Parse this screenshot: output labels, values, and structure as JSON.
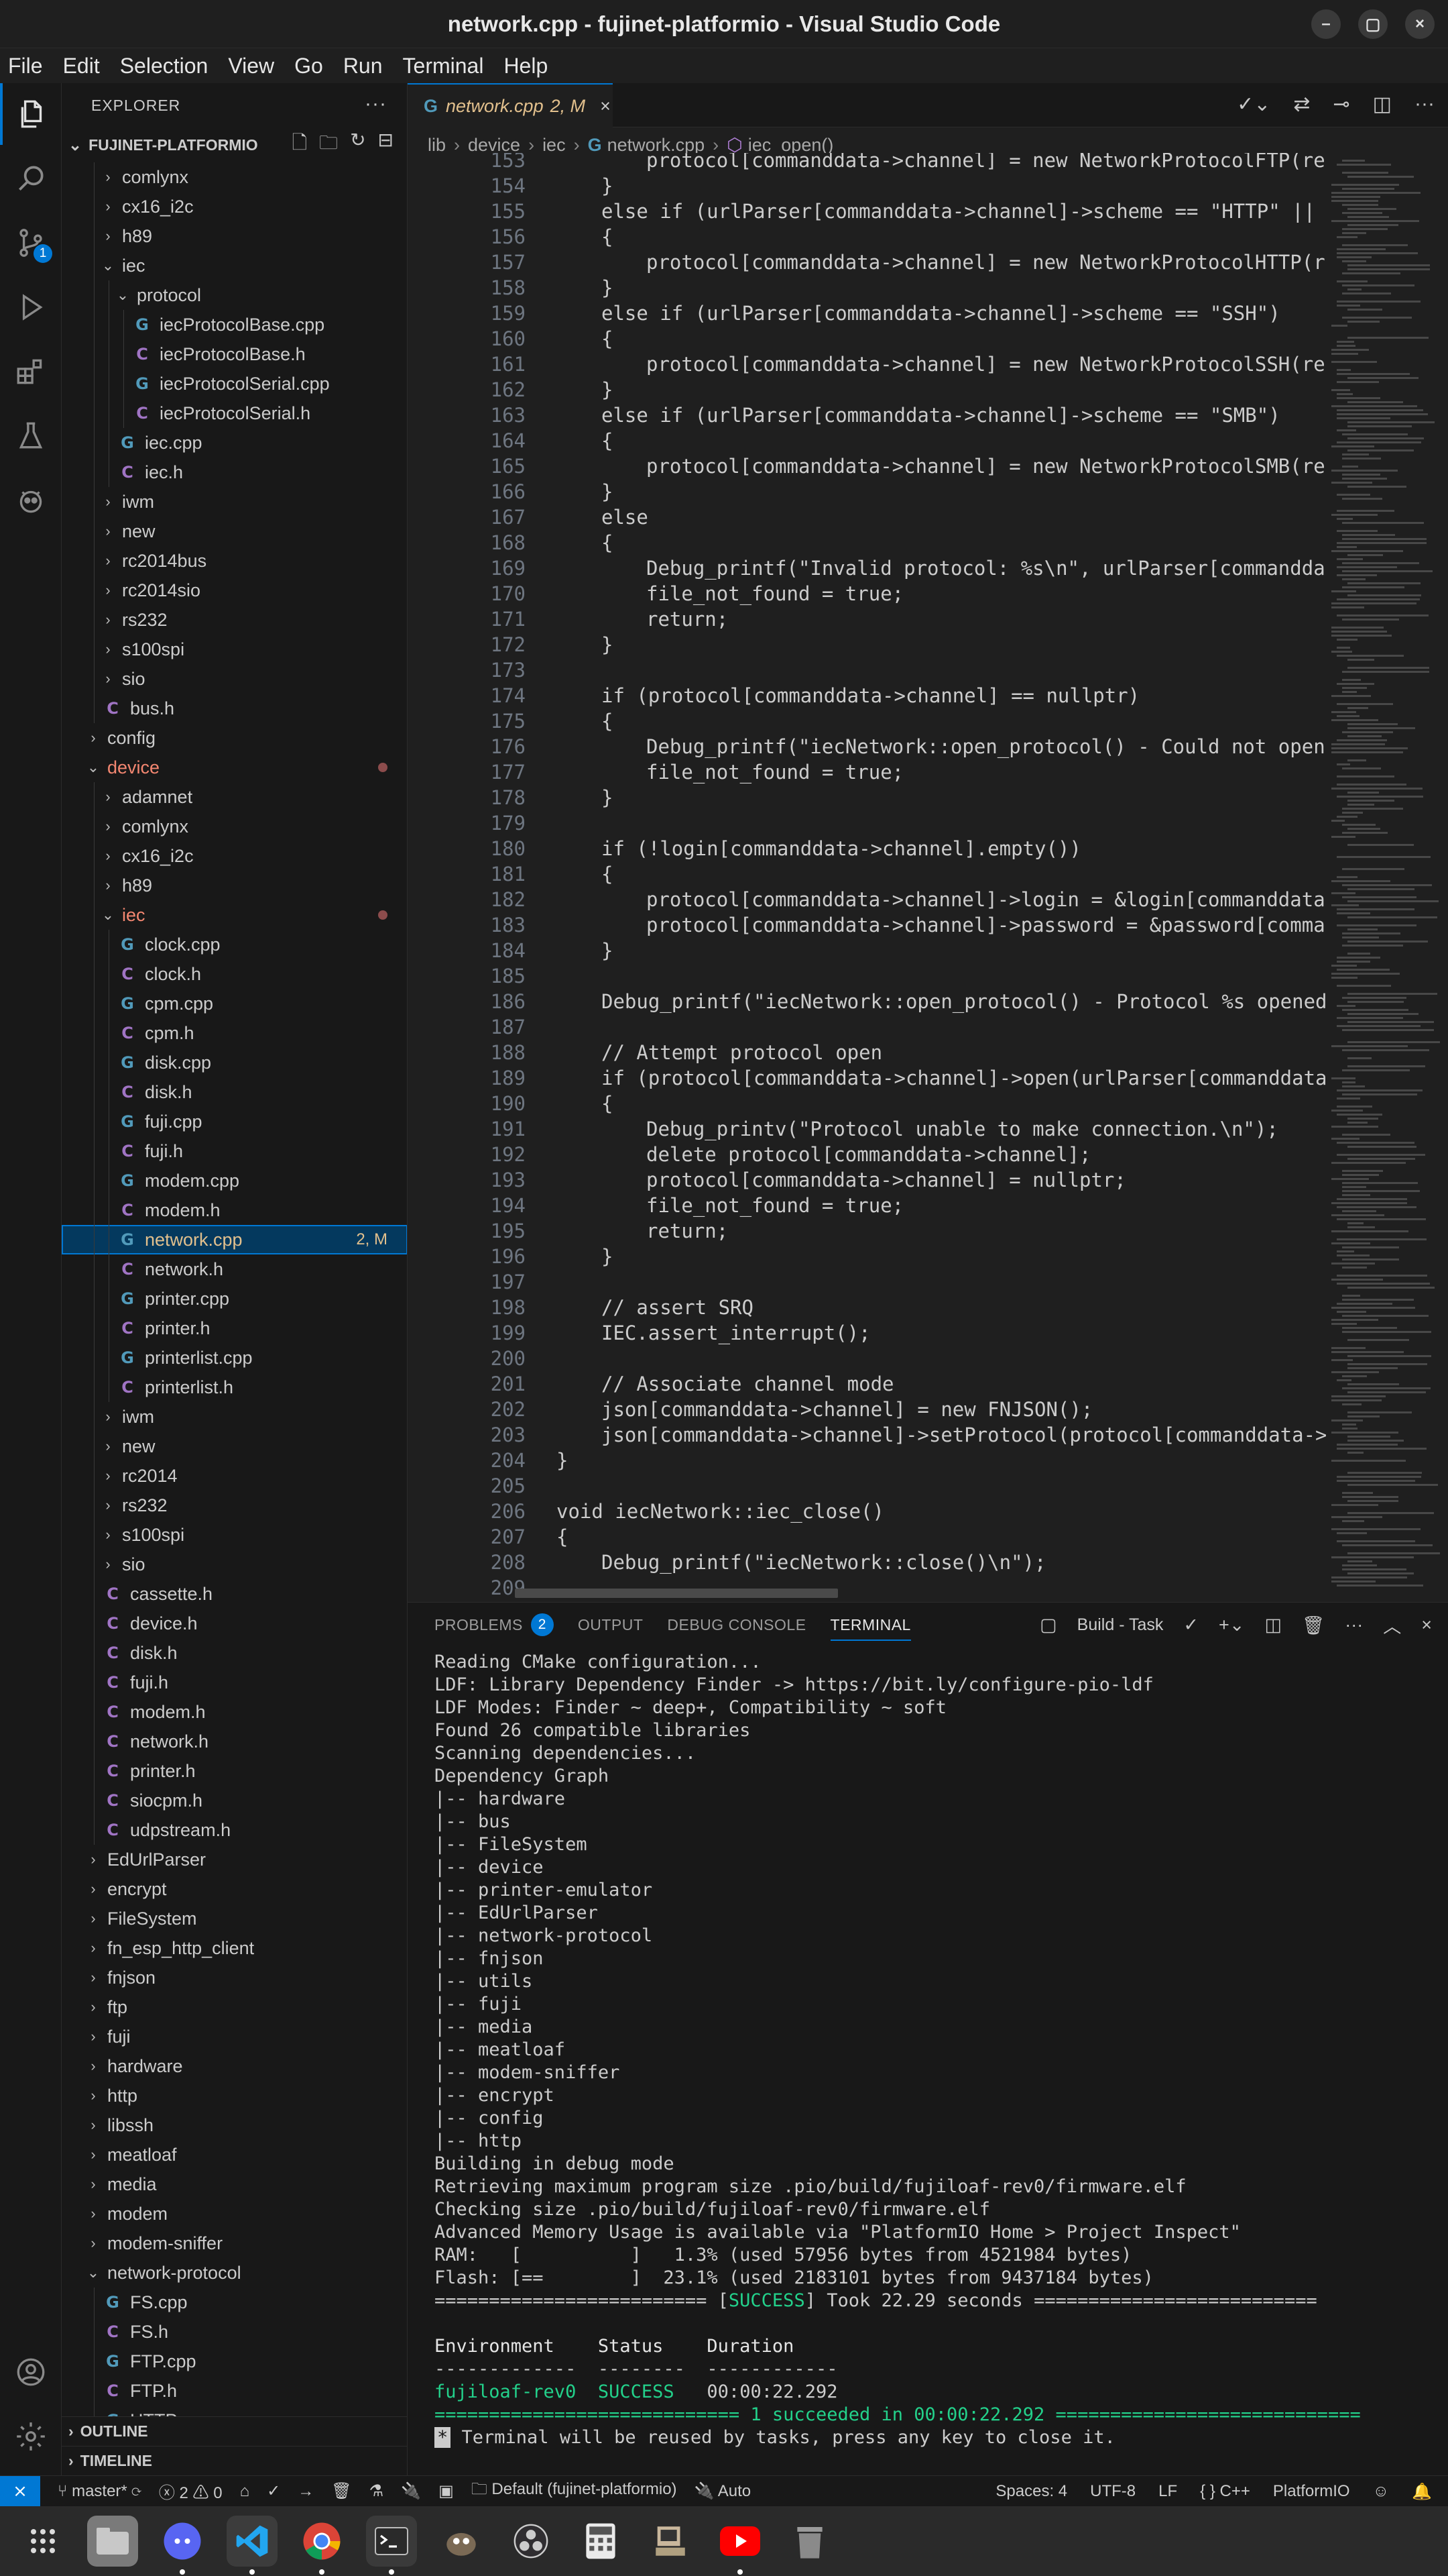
{
  "window": {
    "title": "network.cpp - fujinet-platformio - Visual Studio Code"
  },
  "menu": [
    "File",
    "Edit",
    "Selection",
    "View",
    "Go",
    "Run",
    "Terminal",
    "Help"
  ],
  "activity": {
    "scm_badge": "1"
  },
  "sidebar": {
    "title": "EXPLORER",
    "root": "FUJINET-PLATFORMIO",
    "tree": [
      {
        "label": "comlynx",
        "depth": 2,
        "kind": "folder",
        "open": false
      },
      {
        "label": "cx16_i2c",
        "depth": 2,
        "kind": "folder",
        "open": false
      },
      {
        "label": "h89",
        "depth": 2,
        "kind": "folder",
        "open": false
      },
      {
        "label": "iec",
        "depth": 2,
        "kind": "folder",
        "open": true
      },
      {
        "label": "protocol",
        "depth": 3,
        "kind": "folder",
        "open": true
      },
      {
        "label": "iecProtocolBase.cpp",
        "depth": 4,
        "kind": "cpp"
      },
      {
        "label": "iecProtocolBase.h",
        "depth": 4,
        "kind": "h"
      },
      {
        "label": "iecProtocolSerial.cpp",
        "depth": 4,
        "kind": "cpp"
      },
      {
        "label": "iecProtocolSerial.h",
        "depth": 4,
        "kind": "h"
      },
      {
        "label": "iec.cpp",
        "depth": 3,
        "kind": "cpp"
      },
      {
        "label": "iec.h",
        "depth": 3,
        "kind": "h"
      },
      {
        "label": "iwm",
        "depth": 2,
        "kind": "folder",
        "open": false
      },
      {
        "label": "new",
        "depth": 2,
        "kind": "folder",
        "open": false
      },
      {
        "label": "rc2014bus",
        "depth": 2,
        "kind": "folder",
        "open": false
      },
      {
        "label": "rc2014sio",
        "depth": 2,
        "kind": "folder",
        "open": false
      },
      {
        "label": "rs232",
        "depth": 2,
        "kind": "folder",
        "open": false
      },
      {
        "label": "s100spi",
        "depth": 2,
        "kind": "folder",
        "open": false
      },
      {
        "label": "sio",
        "depth": 2,
        "kind": "folder",
        "open": false
      },
      {
        "label": "bus.h",
        "depth": 2,
        "kind": "h"
      },
      {
        "label": "config",
        "depth": 1,
        "kind": "folder",
        "open": false
      },
      {
        "label": "device",
        "depth": 1,
        "kind": "folder",
        "open": true,
        "err": true
      },
      {
        "label": "adamnet",
        "depth": 2,
        "kind": "folder",
        "open": false
      },
      {
        "label": "comlynx",
        "depth": 2,
        "kind": "folder",
        "open": false
      },
      {
        "label": "cx16_i2c",
        "depth": 2,
        "kind": "folder",
        "open": false
      },
      {
        "label": "h89",
        "depth": 2,
        "kind": "folder",
        "open": false
      },
      {
        "label": "iec",
        "depth": 2,
        "kind": "folder",
        "open": true,
        "err": true
      },
      {
        "label": "clock.cpp",
        "depth": 3,
        "kind": "cpp"
      },
      {
        "label": "clock.h",
        "depth": 3,
        "kind": "h"
      },
      {
        "label": "cpm.cpp",
        "depth": 3,
        "kind": "cpp"
      },
      {
        "label": "cpm.h",
        "depth": 3,
        "kind": "h"
      },
      {
        "label": "disk.cpp",
        "depth": 3,
        "kind": "cpp"
      },
      {
        "label": "disk.h",
        "depth": 3,
        "kind": "h"
      },
      {
        "label": "fuji.cpp",
        "depth": 3,
        "kind": "cpp"
      },
      {
        "label": "fuji.h",
        "depth": 3,
        "kind": "h"
      },
      {
        "label": "modem.cpp",
        "depth": 3,
        "kind": "cpp"
      },
      {
        "label": "modem.h",
        "depth": 3,
        "kind": "h"
      },
      {
        "label": "network.cpp",
        "depth": 3,
        "kind": "cpp",
        "selected": true,
        "status": "2, M"
      },
      {
        "label": "network.h",
        "depth": 3,
        "kind": "h"
      },
      {
        "label": "printer.cpp",
        "depth": 3,
        "kind": "cpp"
      },
      {
        "label": "printer.h",
        "depth": 3,
        "kind": "h"
      },
      {
        "label": "printerlist.cpp",
        "depth": 3,
        "kind": "cpp"
      },
      {
        "label": "printerlist.h",
        "depth": 3,
        "kind": "h"
      },
      {
        "label": "iwm",
        "depth": 2,
        "kind": "folder",
        "open": false
      },
      {
        "label": "new",
        "depth": 2,
        "kind": "folder",
        "open": false
      },
      {
        "label": "rc2014",
        "depth": 2,
        "kind": "folder",
        "open": false
      },
      {
        "label": "rs232",
        "depth": 2,
        "kind": "folder",
        "open": false
      },
      {
        "label": "s100spi",
        "depth": 2,
        "kind": "folder",
        "open": false
      },
      {
        "label": "sio",
        "depth": 2,
        "kind": "folder",
        "open": false
      },
      {
        "label": "cassette.h",
        "depth": 2,
        "kind": "h"
      },
      {
        "label": "device.h",
        "depth": 2,
        "kind": "h"
      },
      {
        "label": "disk.h",
        "depth": 2,
        "kind": "h"
      },
      {
        "label": "fuji.h",
        "depth": 2,
        "kind": "h"
      },
      {
        "label": "modem.h",
        "depth": 2,
        "kind": "h"
      },
      {
        "label": "network.h",
        "depth": 2,
        "kind": "h"
      },
      {
        "label": "printer.h",
        "depth": 2,
        "kind": "h"
      },
      {
        "label": "siocpm.h",
        "depth": 2,
        "kind": "h"
      },
      {
        "label": "udpstream.h",
        "depth": 2,
        "kind": "h"
      },
      {
        "label": "EdUrlParser",
        "depth": 1,
        "kind": "folder",
        "open": false
      },
      {
        "label": "encrypt",
        "depth": 1,
        "kind": "folder",
        "open": false
      },
      {
        "label": "FileSystem",
        "depth": 1,
        "kind": "folder",
        "open": false
      },
      {
        "label": "fn_esp_http_client",
        "depth": 1,
        "kind": "folder",
        "open": false
      },
      {
        "label": "fnjson",
        "depth": 1,
        "kind": "folder",
        "open": false
      },
      {
        "label": "ftp",
        "depth": 1,
        "kind": "folder",
        "open": false
      },
      {
        "label": "fuji",
        "depth": 1,
        "kind": "folder",
        "open": false
      },
      {
        "label": "hardware",
        "depth": 1,
        "kind": "folder",
        "open": false
      },
      {
        "label": "http",
        "depth": 1,
        "kind": "folder",
        "open": false
      },
      {
        "label": "libssh",
        "depth": 1,
        "kind": "folder",
        "open": false
      },
      {
        "label": "meatloaf",
        "depth": 1,
        "kind": "folder",
        "open": false
      },
      {
        "label": "media",
        "depth": 1,
        "kind": "folder",
        "open": false
      },
      {
        "label": "modem",
        "depth": 1,
        "kind": "folder",
        "open": false
      },
      {
        "label": "modem-sniffer",
        "depth": 1,
        "kind": "folder",
        "open": false
      },
      {
        "label": "network-protocol",
        "depth": 1,
        "kind": "folder",
        "open": true
      },
      {
        "label": "FS.cpp",
        "depth": 2,
        "kind": "cpp"
      },
      {
        "label": "FS.h",
        "depth": 2,
        "kind": "h"
      },
      {
        "label": "FTP.cpp",
        "depth": 2,
        "kind": "cpp"
      },
      {
        "label": "FTP.h",
        "depth": 2,
        "kind": "h"
      },
      {
        "label": "HTTP",
        "depth": 2,
        "kind": "cpp"
      }
    ],
    "outline": "OUTLINE",
    "timeline": "TIMELINE"
  },
  "editor": {
    "tab": {
      "name": "network.cpp",
      "meta": "2, M",
      "close": "×"
    },
    "breadcrumb": [
      "lib",
      "device",
      "iec",
      "network.cpp",
      "iec_open()"
    ],
    "lines": [
      {
        "n": "153",
        "i": 2,
        "t": "protocol[commanddata->channel] = new NetworkProtocolFTP(receiveB"
      },
      {
        "n": "154",
        "i": 1,
        "t": "}"
      },
      {
        "n": "155",
        "i": 1,
        "t": "else if (urlParser[commanddata->channel]->scheme == \"HTTP\" || urlPar"
      },
      {
        "n": "156",
        "i": 1,
        "t": "{"
      },
      {
        "n": "157",
        "i": 2,
        "t": "protocol[commanddata->channel] = new NetworkProtocolHTTP(receive"
      },
      {
        "n": "158",
        "i": 1,
        "t": "}"
      },
      {
        "n": "159",
        "i": 1,
        "t": "else if (urlParser[commanddata->channel]->scheme == \"SSH\")"
      },
      {
        "n": "160",
        "i": 1,
        "t": "{"
      },
      {
        "n": "161",
        "i": 2,
        "t": "protocol[commanddata->channel] = new NetworkProtocolSSH(receiveB"
      },
      {
        "n": "162",
        "i": 1,
        "t": "}"
      },
      {
        "n": "163",
        "i": 1,
        "t": "else if (urlParser[commanddata->channel]->scheme == \"SMB\")"
      },
      {
        "n": "164",
        "i": 1,
        "t": "{"
      },
      {
        "n": "165",
        "i": 2,
        "t": "protocol[commanddata->channel] = new NetworkProtocolSMB(receiveB"
      },
      {
        "n": "166",
        "i": 1,
        "t": "}"
      },
      {
        "n": "167",
        "i": 1,
        "t": "else"
      },
      {
        "n": "168",
        "i": 1,
        "t": "{"
      },
      {
        "n": "169",
        "i": 2,
        "t": "Debug_printf(\"Invalid protocol: %s\\n\", urlParser[commanddata->ch"
      },
      {
        "n": "170",
        "i": 2,
        "t": "file_not_found = true;"
      },
      {
        "n": "171",
        "i": 2,
        "t": "return;"
      },
      {
        "n": "172",
        "i": 1,
        "t": "}"
      },
      {
        "n": "173",
        "i": 0,
        "t": ""
      },
      {
        "n": "174",
        "i": 1,
        "t": "if (protocol[commanddata->channel] == nullptr)"
      },
      {
        "n": "175",
        "i": 1,
        "t": "{"
      },
      {
        "n": "176",
        "i": 2,
        "t": "Debug_printf(\"iecNetwork::open_protocol() - Could not open proto"
      },
      {
        "n": "177",
        "i": 2,
        "t": "file_not_found = true;"
      },
      {
        "n": "178",
        "i": 1,
        "t": "}"
      },
      {
        "n": "179",
        "i": 0,
        "t": ""
      },
      {
        "n": "180",
        "i": 1,
        "t": "if (!login[commanddata->channel].empty())"
      },
      {
        "n": "181",
        "i": 1,
        "t": "{"
      },
      {
        "n": "182",
        "i": 2,
        "t": "protocol[commanddata->channel]->login = &login[commanddata->chan"
      },
      {
        "n": "183",
        "i": 2,
        "t": "protocol[commanddata->channel]->password = &password[commanddata"
      },
      {
        "n": "184",
        "i": 1,
        "t": "}"
      },
      {
        "n": "185",
        "i": 0,
        "t": ""
      },
      {
        "n": "186",
        "i": 1,
        "t": "Debug_printf(\"iecNetwork::open_protocol() - Protocol %s opened.\\n\","
      },
      {
        "n": "187",
        "i": 0,
        "t": ""
      },
      {
        "n": "188",
        "i": 1,
        "t": "// Attempt protocol open"
      },
      {
        "n": "189",
        "i": 1,
        "t": "if (protocol[commanddata->channel]->open(urlParser[commanddata->chan"
      },
      {
        "n": "190",
        "i": 1,
        "t": "{"
      },
      {
        "n": "191",
        "i": 2,
        "t": "Debug_printv(\"Protocol unable to make connection.\\n\");"
      },
      {
        "n": "192",
        "i": 2,
        "t": "delete protocol[commanddata->channel];"
      },
      {
        "n": "193",
        "i": 2,
        "t": "protocol[commanddata->channel] = nullptr;"
      },
      {
        "n": "194",
        "i": 2,
        "t": "file_not_found = true;"
      },
      {
        "n": "195",
        "i": 2,
        "t": "return;"
      },
      {
        "n": "196",
        "i": 1,
        "t": "}"
      },
      {
        "n": "197",
        "i": 0,
        "t": ""
      },
      {
        "n": "198",
        "i": 1,
        "t": "// assert SRQ"
      },
      {
        "n": "199",
        "i": 1,
        "t": "IEC.assert_interrupt();"
      },
      {
        "n": "200",
        "i": 0,
        "t": ""
      },
      {
        "n": "201",
        "i": 1,
        "t": "// Associate channel mode"
      },
      {
        "n": "202",
        "i": 1,
        "t": "json[commanddata->channel] = new FNJSON();"
      },
      {
        "n": "203",
        "i": 1,
        "t": "json[commanddata->channel]->setProtocol(protocol[commanddata->channe"
      },
      {
        "n": "204",
        "i": 0,
        "t": "}"
      },
      {
        "n": "205",
        "i": 0,
        "t": ""
      },
      {
        "n": "206",
        "i": 0,
        "t": "void iecNetwork::iec_close()"
      },
      {
        "n": "207",
        "i": 0,
        "t": "{"
      },
      {
        "n": "208",
        "i": 1,
        "t": "Debug_printf(\"iecNetwork::close()\\n\");"
      },
      {
        "n": "209",
        "i": 0,
        "t": ""
      }
    ]
  },
  "panel": {
    "tabs": [
      "PROBLEMS",
      "OUTPUT",
      "DEBUG CONSOLE",
      "TERMINAL"
    ],
    "problems_count": "2",
    "task_label": "Build - Task",
    "terminal": [
      "Reading CMake configuration...",
      "LDF: Library Dependency Finder -> https://bit.ly/configure-pio-ldf",
      "LDF Modes: Finder ~ deep+, Compatibility ~ soft",
      "Found 26 compatible libraries",
      "Scanning dependencies...",
      "Dependency Graph",
      "|-- hardware",
      "|-- bus",
      "|-- FileSystem",
      "|-- device",
      "|-- printer-emulator",
      "|-- EdUrlParser",
      "|-- network-protocol",
      "|-- fnjson",
      "|-- utils",
      "|-- fuji",
      "|-- media",
      "|-- meatloaf",
      "|-- modem-sniffer",
      "|-- encrypt",
      "|-- config",
      "|-- http",
      "Building in debug mode",
      "Retrieving maximum program size .pio/build/fujiloaf-rev0/firmware.elf",
      "Checking size .pio/build/fujiloaf-rev0/firmware.elf",
      "Advanced Memory Usage is available via \"PlatformIO Home > Project Inspect\"",
      "RAM:   [          ]   1.3% (used 57956 bytes from 4521984 bytes)",
      "Flash: [==        ]  23.1% (used 2183101 bytes from 9437184 bytes)"
    ],
    "success_line": {
      "pre": "========================= [",
      "word": "SUCCESS",
      "post": "] Took 22.29 seconds =========================="
    },
    "table_header": "Environment    Status    Duration",
    "table_rule": "-------------  --------  ------------",
    "table_row": {
      "env": "fujiloaf-rev0",
      "status": "SUCCESS",
      "duration": "00:00:22.292"
    },
    "summary": "============================ 1 succeeded in 00:00:22.292 ============================",
    "reuse": {
      "star": "*",
      "text": " Terminal will be reused by tasks, press any key to close it."
    }
  },
  "statusbar": {
    "branch": "master*",
    "errors": "2",
    "warnings": "0",
    "env": "Default (fujinet-platformio)",
    "auto": "Auto",
    "spaces": "Spaces: 4",
    "encoding": "UTF-8",
    "eol": "LF",
    "lang": "C++",
    "platform": "PlatformIO"
  },
  "colors": {
    "accent": "#0078d4",
    "modified": "#e2c08d",
    "error": "#f48771",
    "success": "#23d18b"
  }
}
